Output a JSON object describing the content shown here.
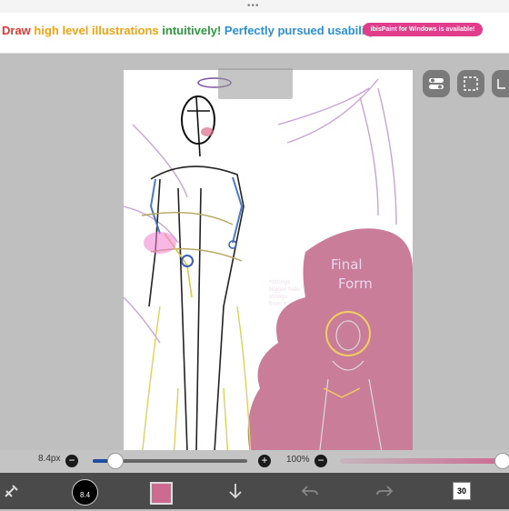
{
  "banner": {
    "seg1": "Draw ",
    "seg2": "high level illustrations ",
    "seg3": "intuitively! ",
    "seg4": "Perfectly pursued usability!",
    "pill": "ibisPaint for Windows is available!"
  },
  "drawing": {
    "title_line1": "Final",
    "title_line2": "Form",
    "note": "*strings\nbigger halo\nstrings\nfrom K"
  },
  "brush_size": "8.4px",
  "brush_size_fraction": 0.14,
  "opacity": "100%",
  "opacity_fraction": 1.0,
  "brush_label": "8.4",
  "layer_count": "30",
  "colors": {
    "accent": "#cc6a90",
    "slider_blue": "#1f4fa0",
    "toolbar": "#4a4a4a",
    "blob": "#c4728f"
  },
  "icons": {
    "tool_toggle": "toggle-icon",
    "selection": "selection-icon",
    "transform": "transform-icon",
    "undo": "undo-icon",
    "redo": "redo-icon",
    "download": "download-icon",
    "tools": "tools-icon"
  }
}
